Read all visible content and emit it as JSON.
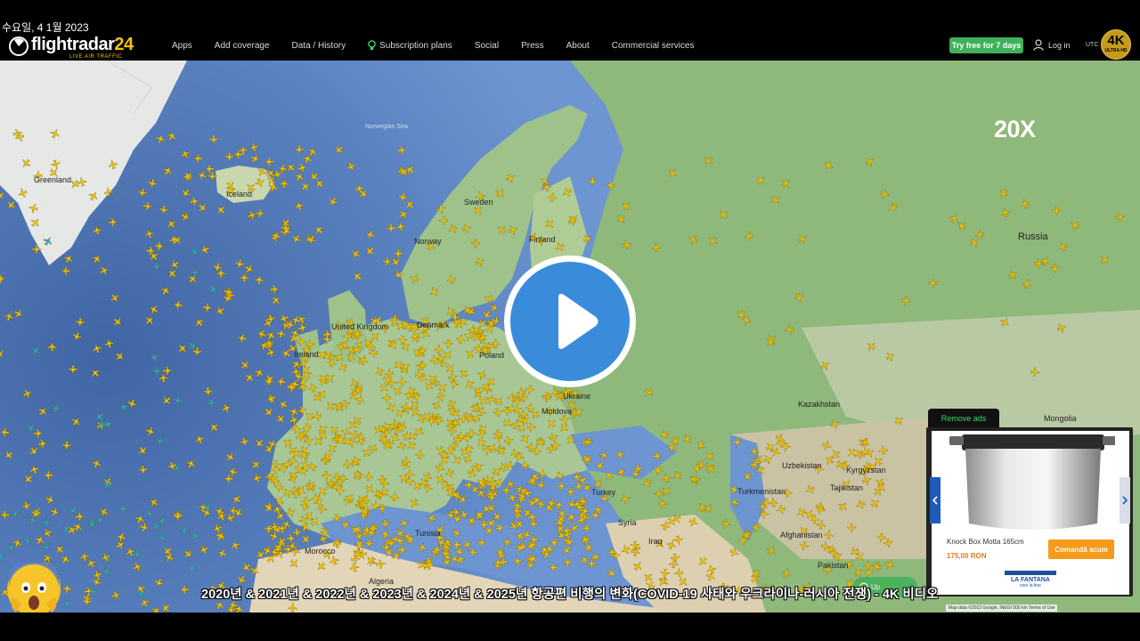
{
  "date_stamp": "수요일, 4 1월 2023",
  "brand": {
    "name": "flightradar",
    "number": "24",
    "tagline": "LIVE AIR TRAFFIC"
  },
  "nav": {
    "apps": "Apps",
    "add_coverage": "Add coverage",
    "data_history": "Data / History",
    "subscription_plans": "Subscription plans",
    "social": "Social",
    "press": "Press",
    "about": "About",
    "commercial_services": "Commercial services"
  },
  "header_right": {
    "try_free": "Try free for 7 days",
    "login": "Log in",
    "utc": "UTC",
    "badge_4k": "4K",
    "badge_sub": "ULTRA HD"
  },
  "map_labels": {
    "greenland": "Greenland",
    "iceland": "Iceland",
    "norwegian_sea": "Norwegian Sea",
    "sweden": "Sweden",
    "finland": "Finland",
    "norway": "Norway",
    "russia": "Russia",
    "denmark": "Denmark",
    "united_kingdom": "United Kingdom",
    "ireland": "Ireland",
    "poland": "Poland",
    "ukraine": "Ukraine",
    "moldova": "Moldova",
    "kazakhstan": "Kazakhstan",
    "mongolia": "Mongolia",
    "uzbekistan": "Uzbekistan",
    "kyrgyzstan": "Kyrgyzstan",
    "tajikistan": "Tajikistan",
    "turkmenistan": "Turkmenistan",
    "turkey": "Turkey",
    "syria": "Syria",
    "iraq": "Iraq",
    "afghanistan": "Afghanistan",
    "pakistan": "Pakistan",
    "tunisia": "Tunisia",
    "morocco": "Morocco",
    "algeria": "Algeria"
  },
  "playback_speed": "20X",
  "ad": {
    "remove_ads": "Remove ads",
    "product_name": "Knock Box Motta 165cm",
    "price": "175,00 RON",
    "cta": "Comandă acum",
    "brand": "LA FANTANA",
    "brand_tagline": "vine la tine"
  },
  "scroll_button": "Up",
  "caption": "2020년 & 2021년 & 2022년 & 2023년 & 2024년 & 2025년 항공편 비행의 변화(COVID-19 사태와 우크라이나-러시아 전쟁) - 4K 비디오",
  "map_attribution": "Map data ©2023 Google, INEGI   500 km   Terms of Use",
  "colors": {
    "plane": "#f5c400",
    "plane_alt": "#29a8d8",
    "accent_green": "#3fb15a",
    "play_blue": "#3a8cdb"
  }
}
